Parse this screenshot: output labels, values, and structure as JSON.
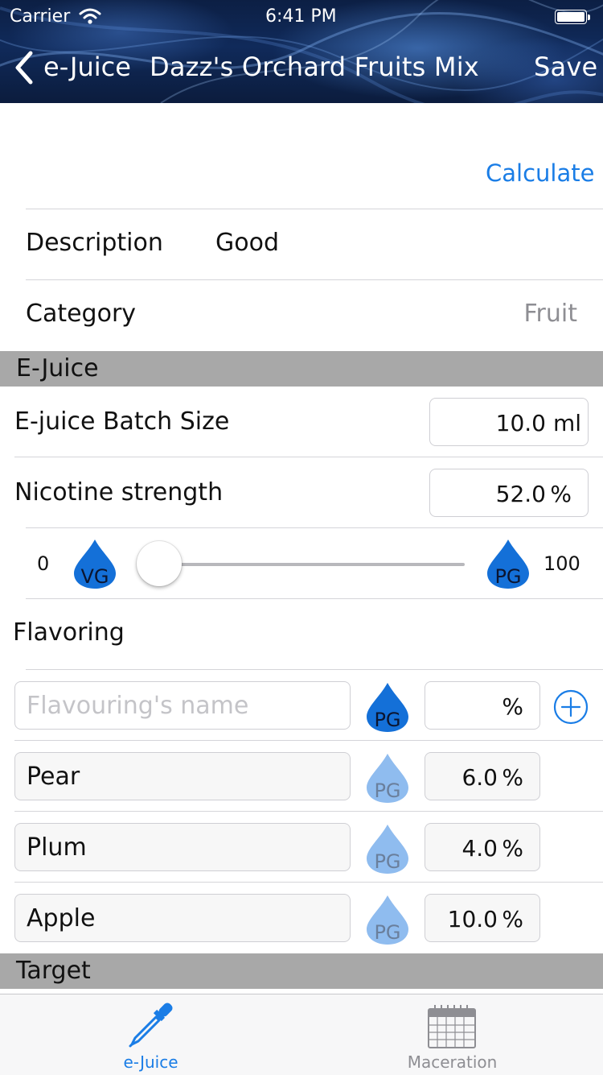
{
  "status_bar": {
    "carrier": "Carrier",
    "time": "6:41 PM"
  },
  "nav": {
    "back_label": "e-Juice",
    "title": "Dazz's Orchard Fruits Mix",
    "save_label": "Save"
  },
  "calculate_label": "Calculate",
  "description": {
    "label": "Description",
    "value": "Good"
  },
  "category": {
    "label": "Category",
    "value": "Fruit"
  },
  "ejuice_section": {
    "header": "E-Juice",
    "batch_size": {
      "label": "E-juice Batch Size",
      "value": "10.0",
      "unit": "ml"
    },
    "nicotine": {
      "label": "Nicotine strength",
      "value": "52.0",
      "unit": "%"
    },
    "ratio": {
      "min_label": "0",
      "max_label": "100",
      "vg_label": "VG",
      "pg_label": "PG",
      "slider_value": 0
    }
  },
  "flavoring": {
    "label": "Flavoring",
    "new_entry": {
      "name_placeholder": "Flavouring's name",
      "base": "PG",
      "percent_unit": "%"
    },
    "items": [
      {
        "name": "Pear",
        "base": "PG",
        "value": "6.0",
        "unit": "%"
      },
      {
        "name": "Plum",
        "base": "PG",
        "value": "4.0",
        "unit": "%"
      },
      {
        "name": "Apple",
        "base": "PG",
        "value": "10.0",
        "unit": "%"
      }
    ]
  },
  "target_section": {
    "header": "Target"
  },
  "tabbar": {
    "tabs": [
      {
        "label": "e-Juice",
        "icon": "dropper-icon",
        "selected": true
      },
      {
        "label": "Maceration",
        "icon": "calendar-icon",
        "selected": false
      }
    ]
  },
  "colors": {
    "accent": "#1a7de6",
    "drop_active": "#1470d8",
    "drop_faded": "#8fbcef",
    "section_bg": "#a8a8a8",
    "placeholder": "#c4c4c8",
    "secondary_text": "#8e8e93"
  }
}
